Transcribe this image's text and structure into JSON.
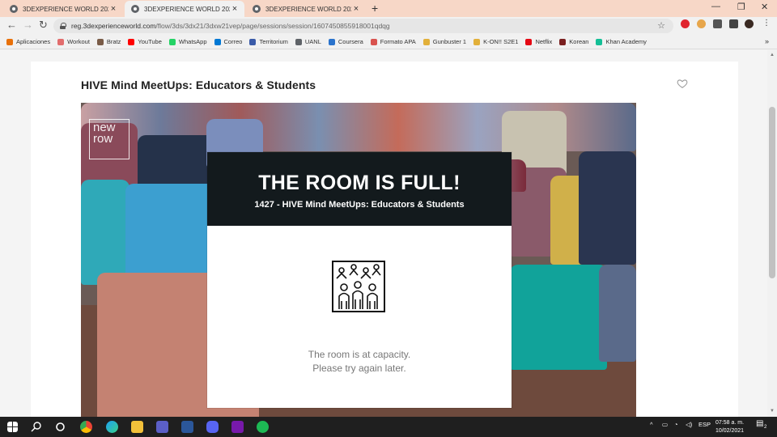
{
  "browser": {
    "tabs": [
      {
        "title": "3DEXPERIENCE WORLD 2021",
        "active": false
      },
      {
        "title": "3DEXPERIENCE WORLD 2021",
        "active": true
      },
      {
        "title": "3DEXPERIENCE WORLD 2021",
        "active": false
      }
    ],
    "url_host": "reg.3dexperienceworld.com",
    "url_path": "/flow/3ds/3dx21/3dxw21vep/page/sessions/session/1607450855918001qdqg",
    "bookmarks": [
      {
        "label": "Aplicaciones",
        "icon": "apps-grid-icon",
        "color": "#e8710a"
      },
      {
        "label": "Workout",
        "icon": "workout-icon",
        "color": "#e26d6d"
      },
      {
        "label": "Bratz",
        "icon": "bratz-icon",
        "color": "#7a5c48"
      },
      {
        "label": "YouTube",
        "icon": "youtube-icon",
        "color": "#ff0000"
      },
      {
        "label": "WhatsApp",
        "icon": "whatsapp-icon",
        "color": "#25d366"
      },
      {
        "label": "Correo",
        "icon": "outlook-icon",
        "color": "#0078d4"
      },
      {
        "label": "Territorium",
        "icon": "territorium-icon",
        "color": "#3a5ba8"
      },
      {
        "label": "UANL",
        "icon": "uanl-icon",
        "color": "#5f6368"
      },
      {
        "label": "Coursera",
        "icon": "coursera-icon",
        "color": "#2a73cc"
      },
      {
        "label": "Formato APA",
        "icon": "apa-icon",
        "color": "#d9534f"
      },
      {
        "label": "Gunbuster 1",
        "icon": "gunbuster-icon",
        "color": "#e2b03a"
      },
      {
        "label": "K-ON!! S2E1",
        "icon": "kon-icon",
        "color": "#e2b03a"
      },
      {
        "label": "Netflix",
        "icon": "netflix-icon",
        "color": "#e50914"
      },
      {
        "label": "Korean",
        "icon": "korean-icon",
        "color": "#7a2020"
      },
      {
        "label": "Khan Academy",
        "icon": "khan-academy-icon",
        "color": "#14bf96"
      }
    ]
  },
  "page": {
    "session_title": "HIVE Mind MeetUps: Educators & Students",
    "logo_text": "new row",
    "modal": {
      "heading": "THE ROOM IS FULL!",
      "subheading": "1427 - HIVE Mind MeetUps: Educators & Students",
      "message_line1": "The room is at capacity.",
      "message_line2": "Please try again later."
    }
  },
  "taskbar": {
    "language": "ESP",
    "time": "07:58 a. m.",
    "date": "10/02/2021",
    "notification_count": "2"
  },
  "colors": {
    "modal_header": "#131a1d",
    "tab_strip": "#f7d7c7"
  }
}
